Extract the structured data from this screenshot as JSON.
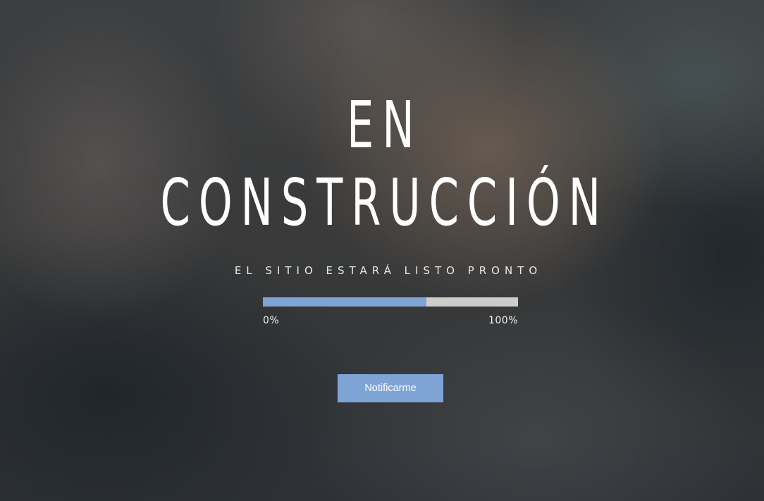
{
  "hero": {
    "title_line1": "EN",
    "title_line2": "CONSTRUCCIÓN",
    "subtitle": "EL SITIO ESTARÁ LISTO PRONTO"
  },
  "progress": {
    "value_percent": 64,
    "min_label": "0%",
    "max_label": "100%",
    "fill_color": "#7ea4d6",
    "track_color": "#cfcdca"
  },
  "actions": {
    "notify_label": "Notificarme",
    "button_color": "#7ea4d6"
  }
}
